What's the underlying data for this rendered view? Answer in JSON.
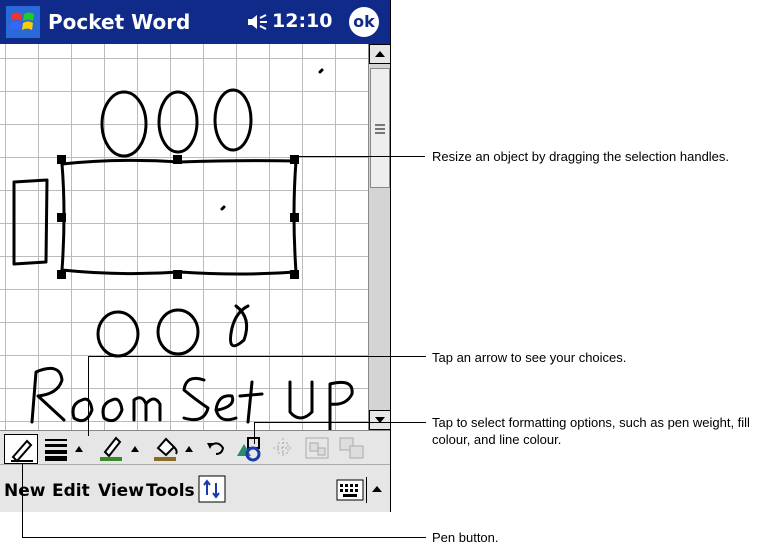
{
  "titlebar": {
    "app_title": "Pocket Word",
    "time": "12:10",
    "ok_label": "ok"
  },
  "menubar": {
    "items": [
      "New",
      "Edit",
      "View",
      "Tools"
    ]
  },
  "drawing": {
    "caption": "Room set up"
  },
  "callouts": {
    "resize": "Resize an object by dragging the selection handles.",
    "arrow": "Tap an arrow to see your choices.",
    "format": "Tap to select formatting options, such as pen weight, fill colour, and line colour.",
    "pen": "Pen button."
  },
  "colors": {
    "titlebar": "#0f2a88",
    "toolbar": "#e6e6e6"
  }
}
